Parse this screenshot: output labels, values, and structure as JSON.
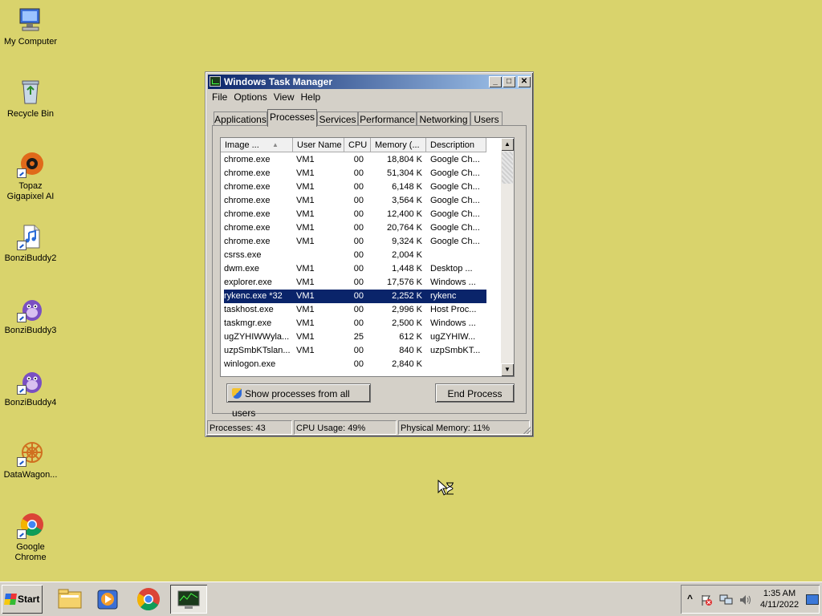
{
  "desktop": {
    "icons": [
      {
        "label": "My Computer"
      },
      {
        "label": "Recycle Bin"
      },
      {
        "label": "Topaz Gigapixel AI"
      },
      {
        "label": "BonziBuddy2"
      },
      {
        "label": "BonziBuddy3"
      },
      {
        "label": "BonziBuddy4"
      },
      {
        "label": "DataWagon..."
      },
      {
        "label": "Google Chrome"
      }
    ]
  },
  "window": {
    "title": "Windows Task Manager",
    "controls": {
      "minimize": "_",
      "maximize": "□",
      "close": "✕"
    },
    "menu": [
      "File",
      "Options",
      "View",
      "Help"
    ],
    "tabs": [
      "Applications",
      "Processes",
      "Services",
      "Performance",
      "Networking",
      "Users"
    ],
    "active_tab": "Processes",
    "columns": [
      "Image ...",
      "User Name",
      "CPU",
      "Memory (...",
      "Description"
    ],
    "rows": [
      {
        "image": "chrome.exe",
        "user": "VM1",
        "cpu": "00",
        "mem": "18,804 K",
        "desc": "Google Ch..."
      },
      {
        "image": "chrome.exe",
        "user": "VM1",
        "cpu": "00",
        "mem": "51,304 K",
        "desc": "Google Ch..."
      },
      {
        "image": "chrome.exe",
        "user": "VM1",
        "cpu": "00",
        "mem": "6,148 K",
        "desc": "Google Ch..."
      },
      {
        "image": "chrome.exe",
        "user": "VM1",
        "cpu": "00",
        "mem": "3,564 K",
        "desc": "Google Ch..."
      },
      {
        "image": "chrome.exe",
        "user": "VM1",
        "cpu": "00",
        "mem": "12,400 K",
        "desc": "Google Ch..."
      },
      {
        "image": "chrome.exe",
        "user": "VM1",
        "cpu": "00",
        "mem": "20,764 K",
        "desc": "Google Ch..."
      },
      {
        "image": "chrome.exe",
        "user": "VM1",
        "cpu": "00",
        "mem": "9,324 K",
        "desc": "Google Ch..."
      },
      {
        "image": "csrss.exe",
        "user": "",
        "cpu": "00",
        "mem": "2,004 K",
        "desc": ""
      },
      {
        "image": "dwm.exe",
        "user": "VM1",
        "cpu": "00",
        "mem": "1,448 K",
        "desc": "Desktop ..."
      },
      {
        "image": "explorer.exe",
        "user": "VM1",
        "cpu": "00",
        "mem": "17,576 K",
        "desc": "Windows ..."
      },
      {
        "image": "rykenc.exe *32",
        "user": "VM1",
        "cpu": "00",
        "mem": "2,252 K",
        "desc": "rykenc"
      },
      {
        "image": "taskhost.exe",
        "user": "VM1",
        "cpu": "00",
        "mem": "2,996 K",
        "desc": "Host Proc..."
      },
      {
        "image": "taskmgr.exe",
        "user": "VM1",
        "cpu": "00",
        "mem": "2,500 K",
        "desc": "Windows ..."
      },
      {
        "image": "ugZYHIWWyla...",
        "user": "VM1",
        "cpu": "25",
        "mem": "612 K",
        "desc": "ugZYHIW..."
      },
      {
        "image": "uzpSmbKTslan...",
        "user": "VM1",
        "cpu": "00",
        "mem": "840 K",
        "desc": "uzpSmbKT..."
      },
      {
        "image": "winlogon.exe",
        "user": "",
        "cpu": "00",
        "mem": "2,840 K",
        "desc": ""
      }
    ],
    "selected_row": 10,
    "show_all_label": "Show processes from all users",
    "end_process_label": "End Process",
    "status": {
      "processes": "Processes: 43",
      "cpu": "CPU Usage: 49%",
      "memory": "Physical Memory: 11%"
    }
  },
  "taskbar": {
    "start_label": "Start",
    "items": [
      "file-explorer",
      "media-player",
      "google-chrome",
      "task-manager"
    ],
    "clock": {
      "time": "1:35 AM",
      "date": "4/11/2022"
    },
    "tray_up": "^"
  }
}
